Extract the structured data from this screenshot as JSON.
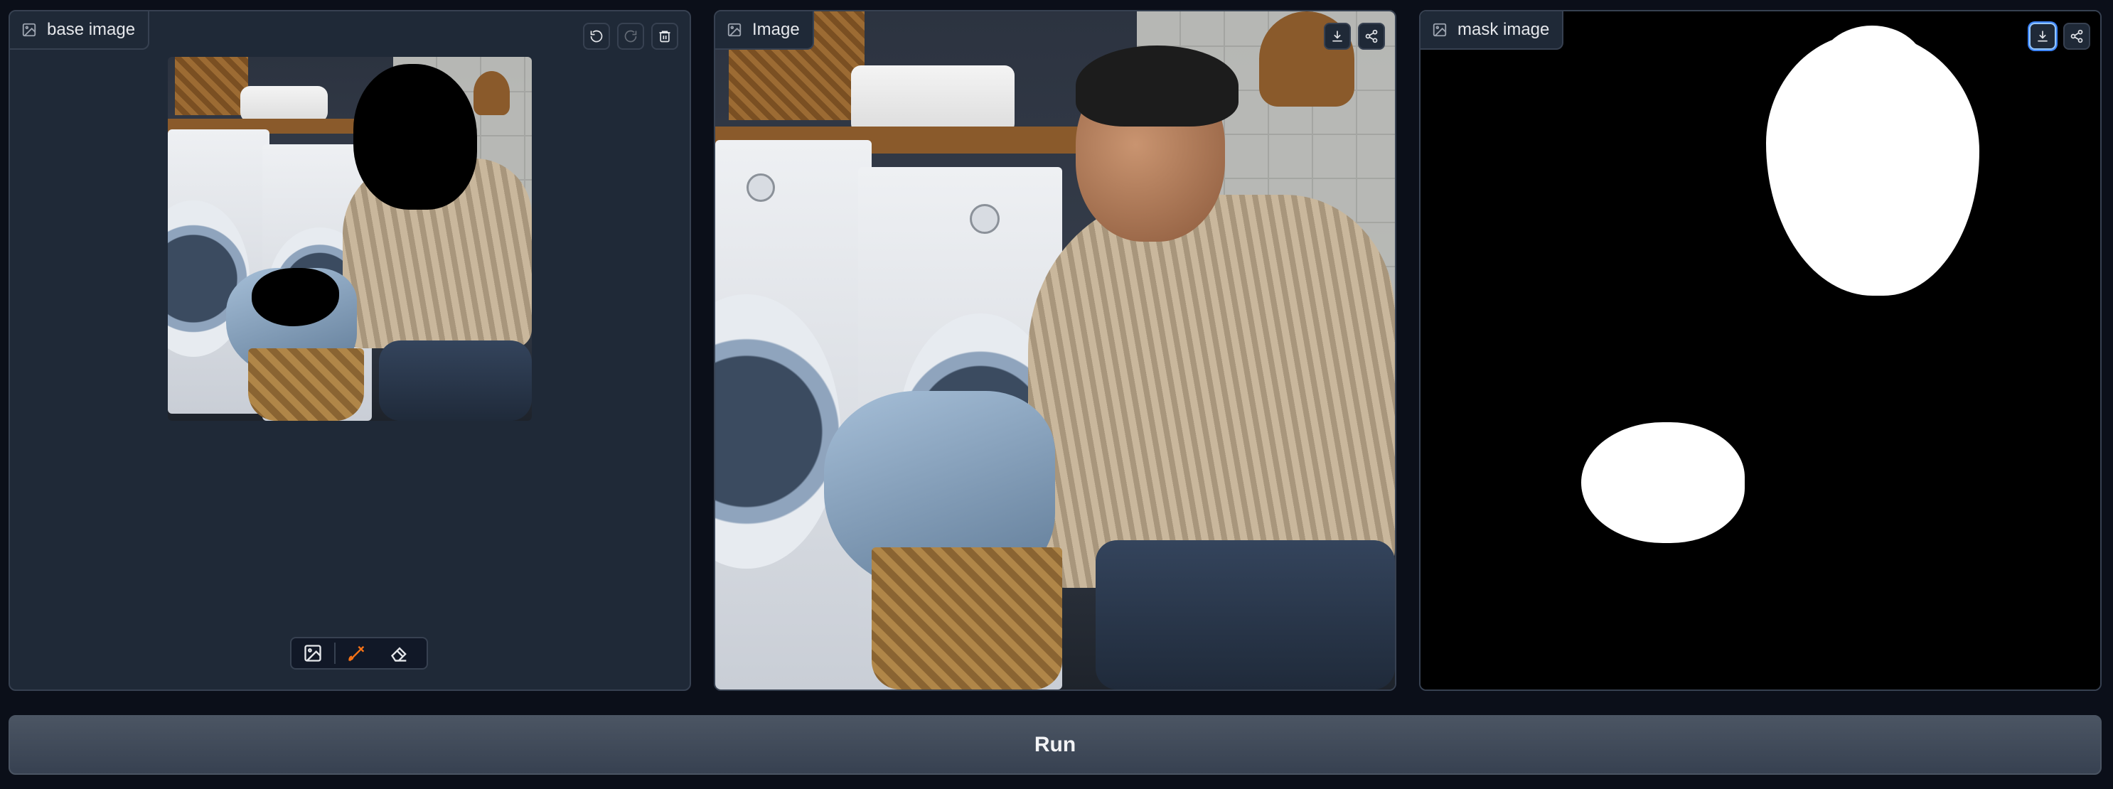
{
  "panels": {
    "base": {
      "label": "base image"
    },
    "output": {
      "label": "Image"
    },
    "mask": {
      "label": "mask image"
    }
  },
  "icons": {
    "undo": "undo-icon",
    "redo": "redo-icon",
    "trash": "trash-icon",
    "download": "download-icon",
    "share": "share-icon",
    "image": "image-icon",
    "brush": "brush-icon",
    "eraser": "eraser-icon"
  },
  "colors": {
    "background": "#0b0f19",
    "panel": "#1f2937",
    "border": "#374151",
    "brush_accent": "#f97316",
    "active_ring": "#3b82f6"
  },
  "run_button": {
    "label": "Run"
  }
}
